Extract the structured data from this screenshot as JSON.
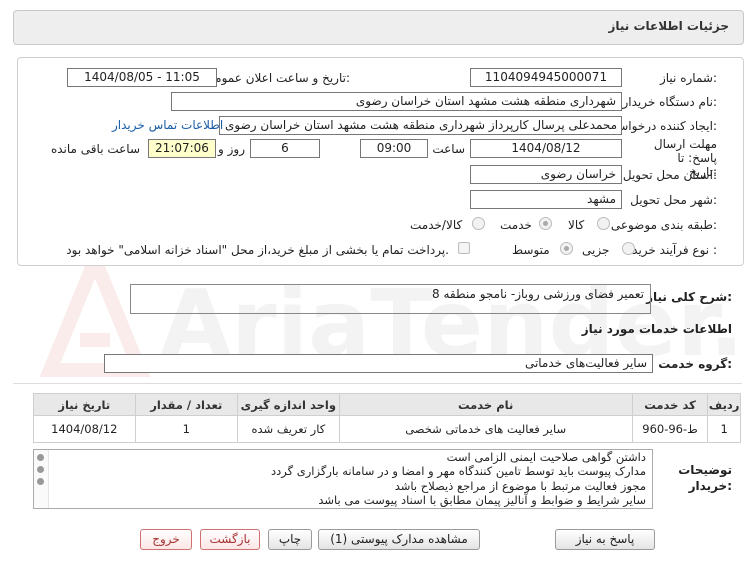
{
  "header": {
    "title": "جزئیات اطلاعات نیاز"
  },
  "form": {
    "need_number_label": "شماره نیاز:",
    "need_number": "1104094945000071",
    "announce_label": "تاریخ و ساعت اعلان عمومی:",
    "announce_value": "1404/08/05 - 11:05",
    "buyer_org_label": "نام دستگاه خریدار:",
    "buyer_org": "شهرداری منطقه هشت مشهد استان خراسان رضوی",
    "creator_label": "ایجاد کننده درخواست:",
    "creator": "محمدعلی پرسال کارپرداز شهرداری منطقه هشت مشهد استان خراسان رضوی",
    "contact_link": "اطلاعات تماس خریدار",
    "deadline_label": "مهلت ارسال پاسخ: تا تاریخ:",
    "deadline_date": "1404/08/12",
    "time_label": "ساعت",
    "deadline_time": "09:00",
    "days_value": "6",
    "days_label": "روز و",
    "remaining_time": "21:07:06",
    "remaining_label": "ساعت باقی مانده",
    "province_label": "استان محل تحویل:",
    "province": "خراسان رضوی",
    "city_label": "شهر محل تحویل:",
    "city": "مشهد",
    "category_label": "طبقه بندی موضوعی:",
    "category_options": [
      "کالا",
      "خدمت",
      "کالا/خدمت"
    ],
    "category_selected": "خدمت",
    "process_label": "نوع فرآیند خرید :",
    "process_options": [
      "جزیی",
      "متوسط"
    ],
    "process_selected": "متوسط",
    "payment_note": "پرداخت تمام یا بخشی از مبلغ خرید،از محل \"اسناد خزانه اسلامی\" خواهد بود."
  },
  "description": {
    "label": "شرح کلی نیاز:",
    "value": "تعمیر فضای ورزشی روباز- نامجو منطقه 8"
  },
  "services": {
    "section_title": "اطلاعات خدمات مورد نیاز",
    "group_label": "گروه خدمت:",
    "group_value": "سایر فعالیت‌های خدماتی",
    "columns": [
      "ردیف",
      "کد خدمت",
      "نام خدمت",
      "واحد اندازه گیری",
      "تعداد / مقدار",
      "تاریخ نیاز"
    ],
    "rows": [
      {
        "row": "1",
        "code": "ط-96-960",
        "name": "سایر فعالیت های خدماتی شخصی",
        "unit": "کار تعریف شده",
        "qty": "1",
        "date": "1404/08/12"
      }
    ]
  },
  "notes": {
    "label": "توضیحات خریدار:",
    "lines": [
      "داشتن  گواهی صلاحیت ایمنی الزامی است",
      "مدارک پیوست باید توسط تامین کنندگاه مهر و امضا و در سامانه بارگزاری گردد",
      "مجوز فعالیت مرتبط با موضوع از مراجع ذیصلاح باشد",
      "سایر شرایط و ضوابط و آنالیز پیمان مطابق با اسناد پیوست می باشد"
    ]
  },
  "buttons": {
    "reply": "پاسخ به نیاز",
    "attachments": "مشاهده مدارک پیوستی (1)",
    "print": "چاپ",
    "back": "بازگشت",
    "exit": "خروج"
  },
  "watermark": {
    "text": "AriaTender.net"
  },
  "colors": {
    "link": "#1a5ea8",
    "time_bg": "#ffffcc",
    "exit_red": "#a83232"
  }
}
